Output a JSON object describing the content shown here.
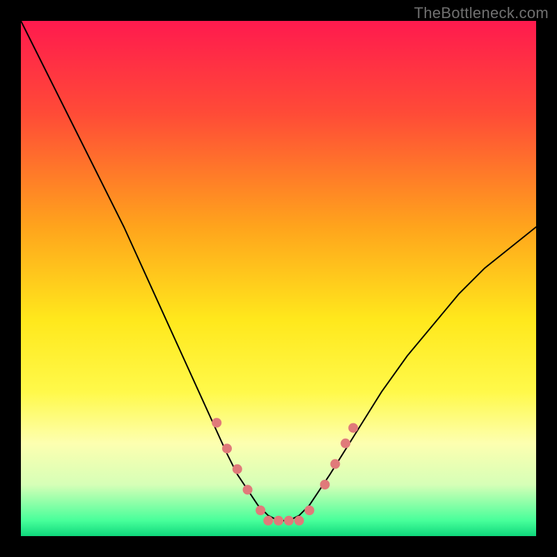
{
  "watermark": "TheBottleneck.com",
  "chart_data": {
    "type": "line",
    "title": "",
    "xlabel": "",
    "ylabel": "",
    "xlim": [
      0,
      100
    ],
    "ylim": [
      0,
      100
    ],
    "background_gradient": {
      "stops": [
        {
          "offset": 0,
          "color": "#ff1a4e"
        },
        {
          "offset": 18,
          "color": "#ff4b37"
        },
        {
          "offset": 40,
          "color": "#ffa41c"
        },
        {
          "offset": 58,
          "color": "#ffe81c"
        },
        {
          "offset": 72,
          "color": "#fff94a"
        },
        {
          "offset": 82,
          "color": "#fdffb0"
        },
        {
          "offset": 90,
          "color": "#d6ffb7"
        },
        {
          "offset": 97,
          "color": "#47ff9a"
        },
        {
          "offset": 100,
          "color": "#0fd87c"
        }
      ]
    },
    "series": [
      {
        "name": "curve",
        "color": "#000000",
        "stroke_width": 2,
        "x": [
          0,
          5,
          10,
          15,
          20,
          25,
          30,
          35,
          40,
          42,
          44,
          46,
          48,
          50,
          52,
          54,
          56,
          58,
          60,
          65,
          70,
          75,
          80,
          85,
          90,
          95,
          100
        ],
        "y": [
          100,
          90,
          80,
          70,
          60,
          49,
          38,
          27,
          16,
          12,
          9,
          6,
          4,
          3,
          3,
          4,
          6,
          9,
          12,
          20,
          28,
          35,
          41,
          47,
          52,
          56,
          60
        ]
      }
    ],
    "markers": {
      "color": "#e07a7a",
      "radius": 7,
      "points_xy": [
        [
          38,
          22
        ],
        [
          40,
          17
        ],
        [
          42,
          13
        ],
        [
          44,
          9
        ],
        [
          46.5,
          5
        ],
        [
          48,
          3
        ],
        [
          50,
          3
        ],
        [
          52,
          3
        ],
        [
          54,
          3
        ],
        [
          56,
          5
        ],
        [
          59,
          10
        ],
        [
          61,
          14
        ],
        [
          63,
          18
        ],
        [
          64.5,
          21
        ]
      ]
    }
  }
}
